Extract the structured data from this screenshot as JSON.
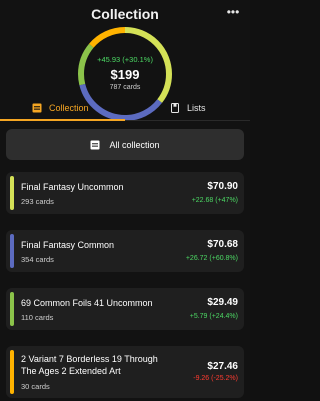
{
  "header": {
    "title": "Collection",
    "more_icon": "ellipsis-icon",
    "more_label": "•••"
  },
  "summary": {
    "change": "+45.93 (+30.1%)",
    "total": "$199",
    "cards": "787 cards",
    "ring_segments": [
      {
        "color": "#d4e157",
        "fraction": 0.355
      },
      {
        "color": "#5c6bc0",
        "fraction": 0.355
      },
      {
        "color": "#8bc34a",
        "fraction": 0.15
      },
      {
        "color": "#ffb300",
        "fraction": 0.14
      }
    ]
  },
  "tabs": [
    {
      "label": "Collection",
      "icon": "collection-icon",
      "active": true
    },
    {
      "label": "Lists",
      "icon": "list-icon",
      "active": false
    }
  ],
  "all_collection": {
    "label": "All collection",
    "icon": "collection-icon"
  },
  "colors": {
    "accent": "#f5a623",
    "positive": "#4cd964",
    "negative": "#ff3b30"
  },
  "items": [
    {
      "name": "Final Fantasy Uncommon",
      "count": "293 cards",
      "value": "$70.90",
      "change": "+22.68 (+47%)",
      "color": "#d4e157",
      "trend": "up"
    },
    {
      "name": "Final Fantasy Common",
      "count": "354 cards",
      "value": "$70.68",
      "change": "+26.72 (+60.8%)",
      "color": "#5c6bc0",
      "trend": "up"
    },
    {
      "name": "69 Common Foils 41 Uncommon",
      "count": "110 cards",
      "value": "$29.49",
      "change": "+5.79 (+24.4%)",
      "color": "#8bc34a",
      "trend": "up"
    },
    {
      "name": "2  Variant 7 Borderless 19 Through The Ages 2 Extended Art",
      "count": "30 cards",
      "value": "$27.46",
      "change": "-9.26 (-25.2%)",
      "color": "#ffb300",
      "trend": "down"
    }
  ]
}
